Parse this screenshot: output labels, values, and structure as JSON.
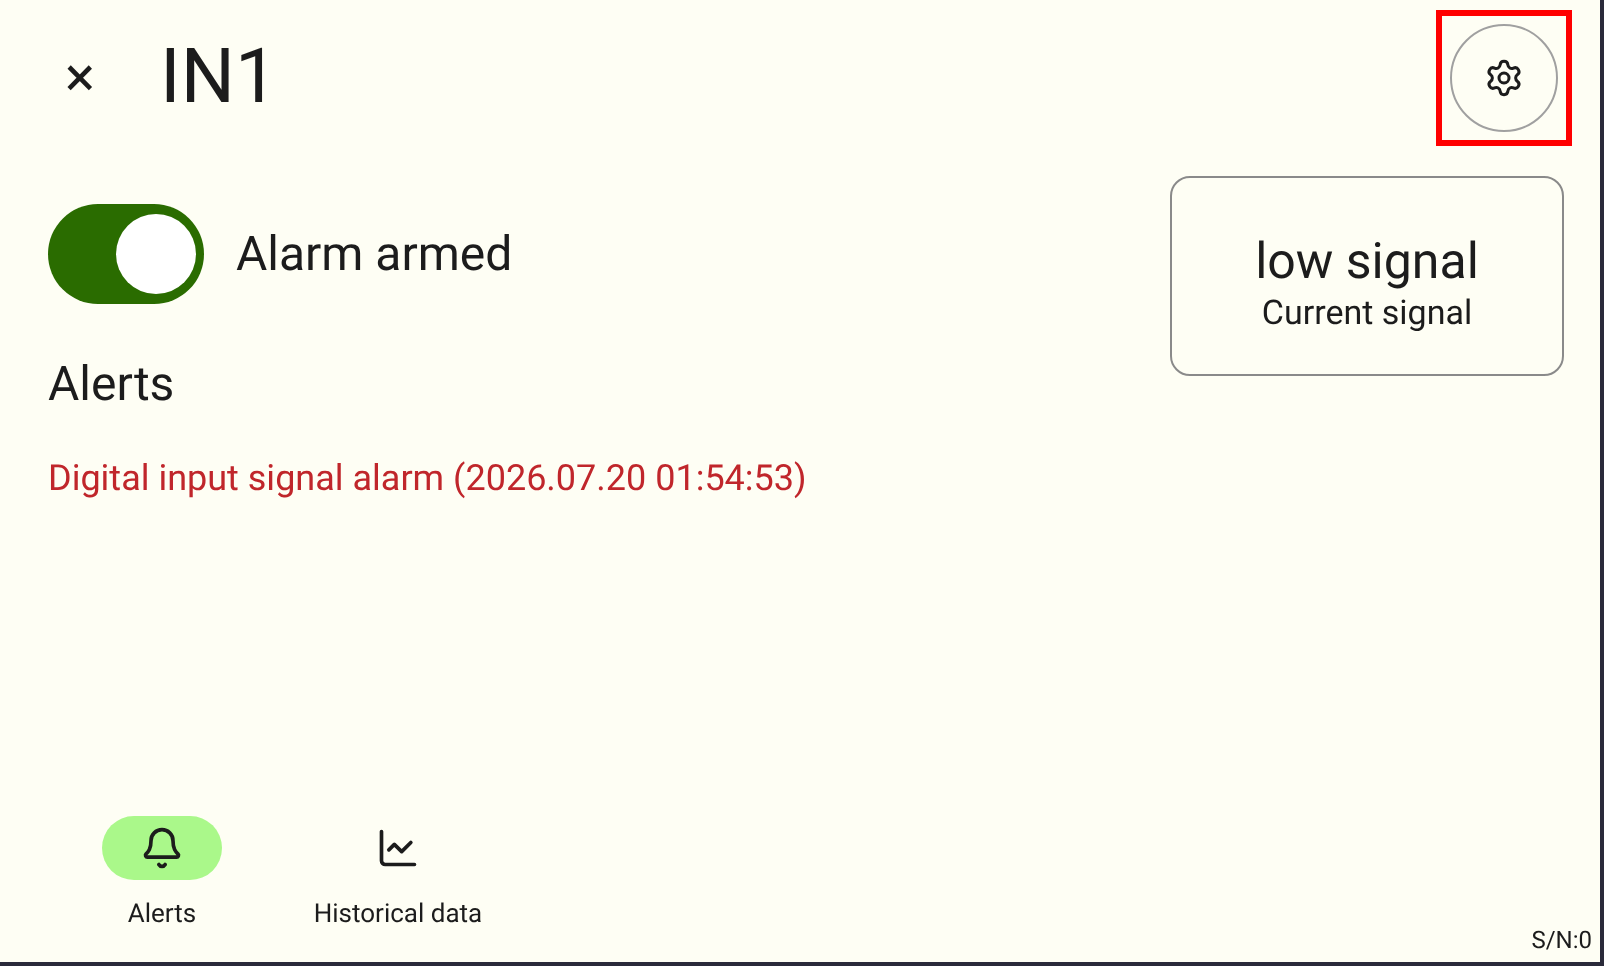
{
  "header": {
    "close": "×",
    "title": "IN1",
    "settings": {
      "highlighted": true
    }
  },
  "alarm": {
    "label": "Alarm armed",
    "on": true
  },
  "signal_card": {
    "value": "low signal",
    "caption": "Current signal"
  },
  "alerts": {
    "heading": "Alerts",
    "items": [
      "Digital input signal alarm (2026.07.20 01:54:53)"
    ]
  },
  "nav": [
    {
      "label": "Alerts",
      "kind": "bell",
      "selected": true
    },
    {
      "label": "Historical data",
      "kind": "chart",
      "selected": false
    }
  ],
  "serial": "S/N:0"
}
